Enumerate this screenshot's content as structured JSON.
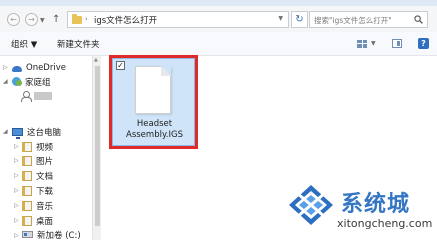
{
  "window": {
    "title": ""
  },
  "address": {
    "path": "igs文件怎么打开",
    "search_placeholder": "搜索\"igs文件怎么打开\""
  },
  "toolbar": {
    "organize_label": "组织 ▼",
    "new_folder_label": "新建文件夹"
  },
  "navigation": {
    "onedrive": "OneDrive",
    "homegroup": "家庭组",
    "this_pc": "这台电脑",
    "videos": "视频",
    "pictures": "图片",
    "documents": "文档",
    "downloads": "下载",
    "music": "音乐",
    "desktop": "桌面",
    "drive_c": "新加卷 (C:)"
  },
  "files": [
    {
      "name_line1": "Headset",
      "name_line2": "Assembly.IGS",
      "selected": true
    }
  ],
  "watermark": {
    "name": "系统城",
    "domain": "xitongcheng.com"
  },
  "colors": {
    "selection_fill": "#cfe4f8",
    "highlight_border": "#e02a2a",
    "brand_blue": "#3476c4"
  }
}
